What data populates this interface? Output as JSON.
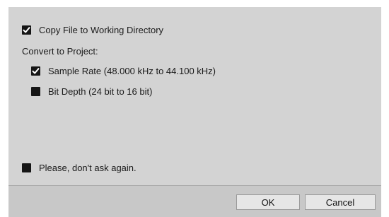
{
  "options": {
    "copy_file": {
      "label": "Copy File to Working Directory",
      "checked": true
    },
    "convert_heading": "Convert to Project:",
    "sample_rate": {
      "label": "Sample Rate (48.000 kHz to 44.100 kHz)",
      "checked": true
    },
    "bit_depth": {
      "label": "Bit Depth (24 bit to 16 bit)",
      "checked": false
    },
    "dont_ask": {
      "label": "Please, don't ask again.",
      "checked": false
    }
  },
  "buttons": {
    "ok_label": "OK",
    "cancel_label": "Cancel"
  },
  "colors": {
    "panel_background": "#d3d3d3",
    "footer_background": "#c8c8c8",
    "checkbox_fill": "#151515",
    "checkmark": "#ffffff"
  }
}
